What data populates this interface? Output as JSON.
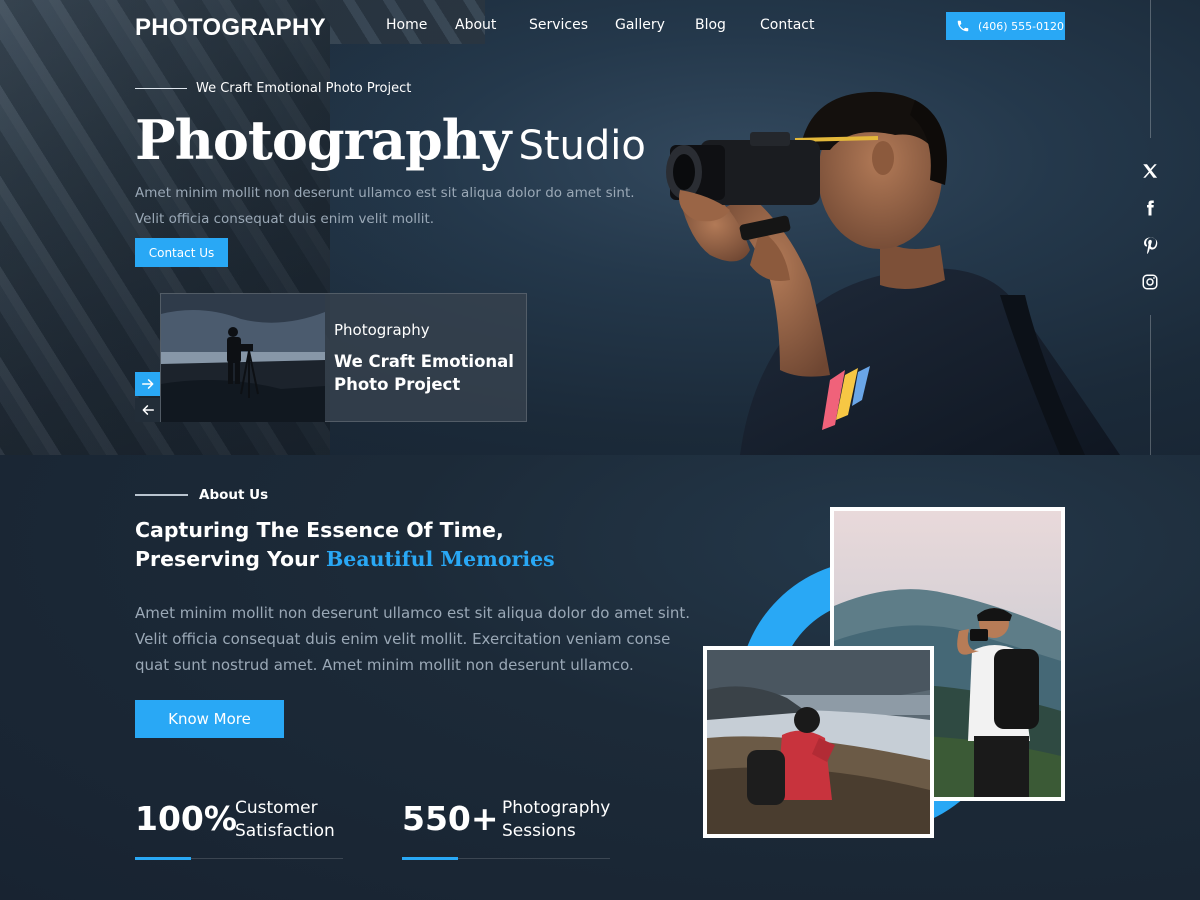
{
  "brand": {
    "logo": "PHOTOGRAPHY",
    "accent": "#29a8f5"
  },
  "nav": {
    "items": [
      "Home",
      "About",
      "Services",
      "Gallery",
      "Blog",
      "Contact"
    ],
    "phone": "(406) 555-0120"
  },
  "social": [
    "x-icon",
    "facebook-icon",
    "pinterest-icon",
    "instagram-icon"
  ],
  "hero": {
    "tagline": "We Craft Emotional Photo Project",
    "title_bold": "Photography",
    "title_light": "Studio",
    "description": "Amet minim mollit non deserunt ullamco est sit aliqua dolor do amet sint. Velit officia consequat duis enim velit mollit.",
    "cta": "Contact Us",
    "slide": {
      "kicker": "Photography",
      "title": "We Craft Emotional Photo Project"
    }
  },
  "about": {
    "kicker": "About Us",
    "heading_line1": "Capturing The Essence Of Time,",
    "heading_line2": "Preserving Your",
    "heading_accent": "Beautiful Memories",
    "description": "Amet minim mollit non deserunt ullamco est sit aliqua dolor do amet sint. Velit officia consequat duis enim velit mollit. Exercitation veniam conse quat sunt nostrud amet. Amet minim mollit non deserunt ullamco.",
    "cta": "Know More",
    "stats": [
      {
        "value": "100%",
        "label": "Customer Satisfaction"
      },
      {
        "value": "550+",
        "label": "Photography Sessions"
      }
    ]
  }
}
